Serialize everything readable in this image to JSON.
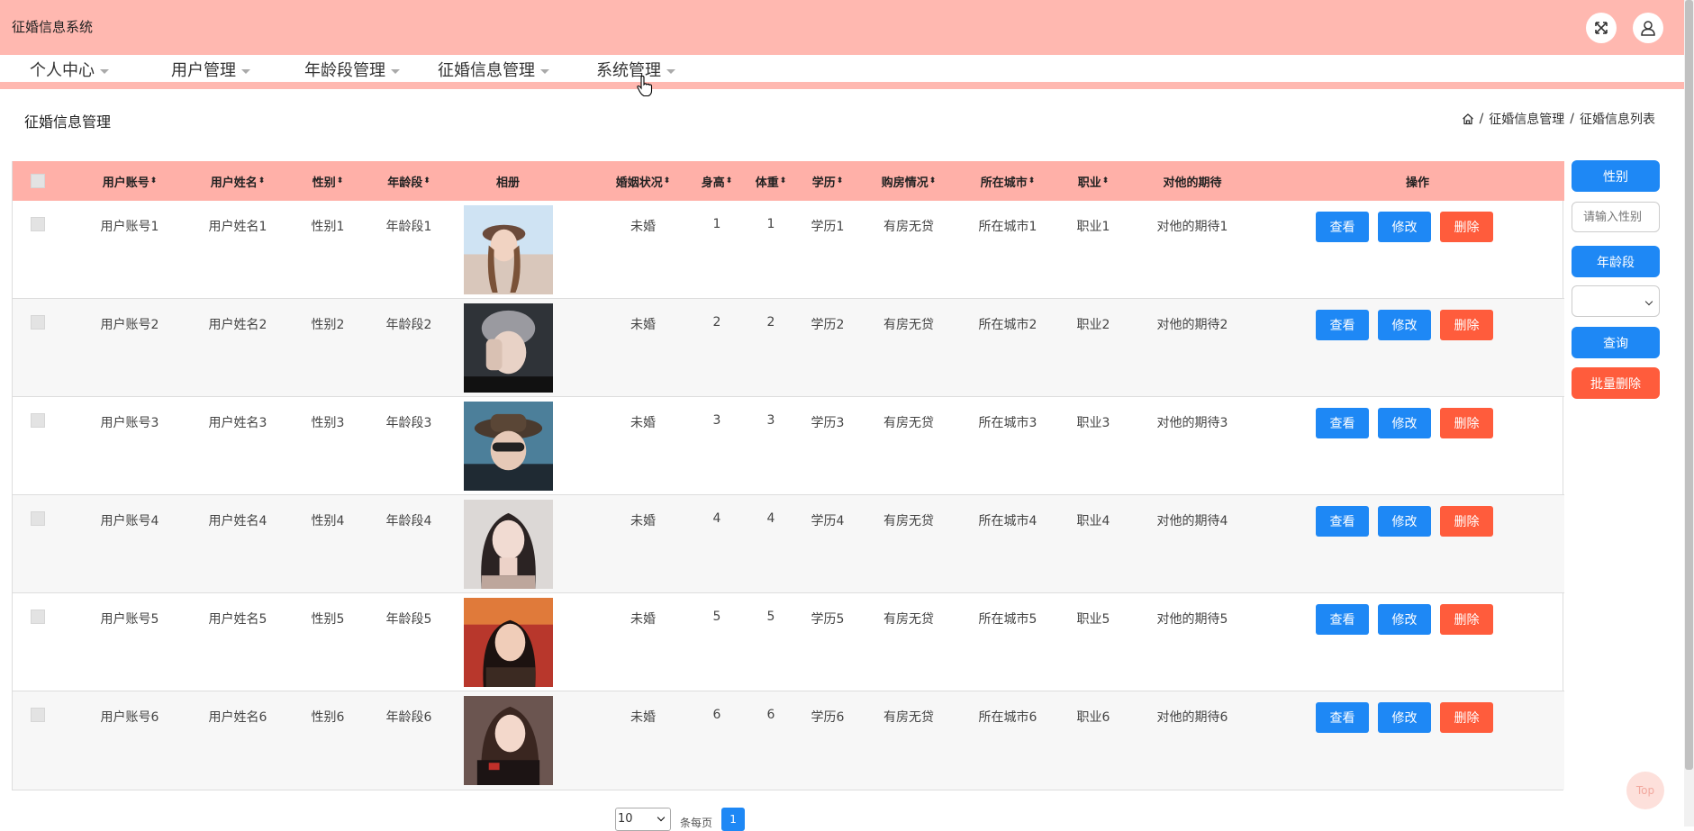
{
  "app": {
    "title": "征婚信息系统"
  },
  "header": {
    "fullscreen_icon": "expand-arrows-icon",
    "user_icon": "user-icon"
  },
  "nav": {
    "items": [
      {
        "label": "个人中心"
      },
      {
        "label": "用户管理"
      },
      {
        "label": "年龄段管理"
      },
      {
        "label": "征婚信息管理"
      },
      {
        "label": "系统管理"
      }
    ]
  },
  "page": {
    "title": "征婚信息管理",
    "breadcrumb": {
      "home_icon": "home-icon",
      "sep": "/",
      "level1": "征婚信息管理",
      "level2": "征婚信息列表"
    }
  },
  "table": {
    "sort_glyph": "⬍",
    "columns": [
      "用户账号",
      "用户姓名",
      "性别",
      "年龄段",
      "相册",
      "婚姻状况",
      "身高",
      "体重",
      "学历",
      "购房情况",
      "所在城市",
      "职业",
      "对他的期待",
      "操作"
    ],
    "rows": [
      {
        "account": "用户账号1",
        "name": "用户姓名1",
        "gender": "性别1",
        "age_group": "年龄段1",
        "marital": "未婚",
        "height": "1",
        "weight": "1",
        "education": "学历1",
        "housing": "有房无贷",
        "city": "所在城市1",
        "job": "职业1",
        "expectation": "对他的期待1"
      },
      {
        "account": "用户账号2",
        "name": "用户姓名2",
        "gender": "性别2",
        "age_group": "年龄段2",
        "marital": "未婚",
        "height": "2",
        "weight": "2",
        "education": "学历2",
        "housing": "有房无贷",
        "city": "所在城市2",
        "job": "职业2",
        "expectation": "对他的期待2"
      },
      {
        "account": "用户账号3",
        "name": "用户姓名3",
        "gender": "性别3",
        "age_group": "年龄段3",
        "marital": "未婚",
        "height": "3",
        "weight": "3",
        "education": "学历3",
        "housing": "有房无贷",
        "city": "所在城市3",
        "job": "职业3",
        "expectation": "对他的期待3"
      },
      {
        "account": "用户账号4",
        "name": "用户姓名4",
        "gender": "性别4",
        "age_group": "年龄段4",
        "marital": "未婚",
        "height": "4",
        "weight": "4",
        "education": "学历4",
        "housing": "有房无贷",
        "city": "所在城市4",
        "job": "职业4",
        "expectation": "对他的期待4"
      },
      {
        "account": "用户账号5",
        "name": "用户姓名5",
        "gender": "性别5",
        "age_group": "年龄段5",
        "marital": "未婚",
        "height": "5",
        "weight": "5",
        "education": "学历5",
        "housing": "有房无贷",
        "city": "所在城市5",
        "job": "职业5",
        "expectation": "对他的期待5"
      },
      {
        "account": "用户账号6",
        "name": "用户姓名6",
        "gender": "性别6",
        "age_group": "年龄段6",
        "marital": "未婚",
        "height": "6",
        "weight": "6",
        "education": "学历6",
        "housing": "有房无贷",
        "city": "所在城市6",
        "job": "职业6",
        "expectation": "对他的期待6"
      }
    ],
    "actions": {
      "view": "查看",
      "edit": "修改",
      "delete": "删除"
    }
  },
  "sidebar": {
    "gender_label": "性别",
    "gender_placeholder": "请输入性别",
    "age_group_label": "年龄段",
    "age_group_value": "",
    "search_label": "查询",
    "batch_delete_label": "批量删除"
  },
  "pagination": {
    "page_size": "10",
    "per_page_text": "条每页",
    "current_page": "1"
  },
  "back_to_top": "Top",
  "colors": {
    "header": "#ffb8b0",
    "table_header": "#ffb0a8",
    "primary": "#1e88f5",
    "danger": "#ff5c3c"
  }
}
